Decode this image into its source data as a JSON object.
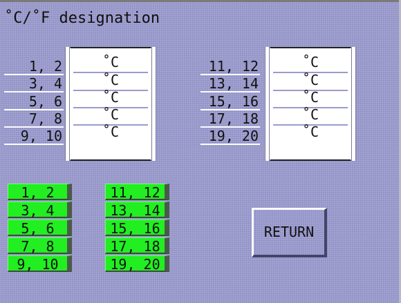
{
  "title": "˚C/˚F designation",
  "left_group": {
    "rows": [
      {
        "label": "1,  2",
        "value": "˚C"
      },
      {
        "label": "3,  4",
        "value": "˚C"
      },
      {
        "label": "5,  6",
        "value": "˚C"
      },
      {
        "label": "7,  8",
        "value": "˚C"
      },
      {
        "label": "9, 10",
        "value": "˚C"
      }
    ]
  },
  "right_group": {
    "rows": [
      {
        "label": "11, 12",
        "value": "˚C"
      },
      {
        "label": "13, 14",
        "value": "˚C"
      },
      {
        "label": "15, 16",
        "value": "˚C"
      },
      {
        "label": "17, 18",
        "value": "˚C"
      },
      {
        "label": "19, 20",
        "value": "˚C"
      }
    ]
  },
  "buttons_left": [
    "1, 2",
    "3, 4",
    "5, 6",
    "7, 8",
    "9, 10"
  ],
  "buttons_right": [
    "11, 12",
    "13, 14",
    "15, 16",
    "17, 18",
    "19, 20"
  ],
  "return_label": "RETURN",
  "colors": {
    "background": "#9a9acd",
    "button_green": "#22ee22",
    "value_box": "#ffffff"
  }
}
